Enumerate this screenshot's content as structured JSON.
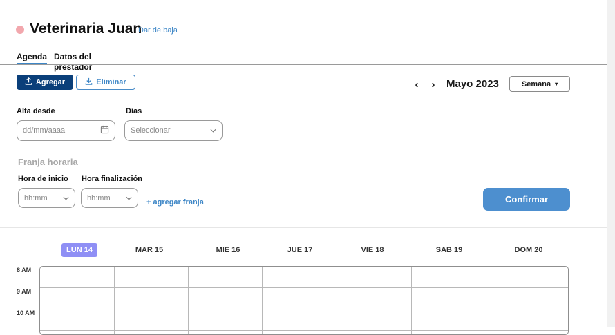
{
  "header": {
    "title": "Veterinaria Juan",
    "unsubscribe_link": "Dar de baja",
    "status_color": "#f2a7ad"
  },
  "tabs": [
    {
      "label": "Agenda",
      "active": true
    },
    {
      "label": "Datos del prestador",
      "active": false
    }
  ],
  "toolbar": {
    "add_label": "Agregar",
    "delete_label": "Eliminar",
    "prev_glyph": "‹",
    "next_glyph": "›",
    "month_label": "Mayo 2023",
    "view_label": "Semana",
    "view_caret": "▾"
  },
  "form": {
    "alta_label": "Alta desde",
    "alta_placeholder": "dd/mm/aaaa",
    "dias_label": "Días",
    "dias_placeholder": "Seleccionar",
    "franja_title": "Franja horaria",
    "hora_inicio_label": "Hora de inicio",
    "hora_inicio_placeholder": "hh:mm",
    "hora_fin_label": "Hora finalización",
    "hora_fin_placeholder": "hh:mm",
    "add_range_label": "+ agregar franja",
    "confirm_label": "Confirmar"
  },
  "calendar": {
    "days": [
      {
        "label": "LUN 14",
        "active": true
      },
      {
        "label": "MAR 15",
        "active": false
      },
      {
        "label": "MIE 16",
        "active": false
      },
      {
        "label": "JUE 17",
        "active": false
      },
      {
        "label": "VIE 18",
        "active": false
      },
      {
        "label": "SAB 19",
        "active": false
      },
      {
        "label": "DOM 20",
        "active": false
      }
    ],
    "hours": [
      "8 AM",
      "9 AM",
      "10 AM"
    ]
  },
  "colors": {
    "primary_dark": "#0a3f7a",
    "accent": "#3d86c6",
    "confirm": "#4d8fcf",
    "day_active": "#8f8ff5"
  }
}
